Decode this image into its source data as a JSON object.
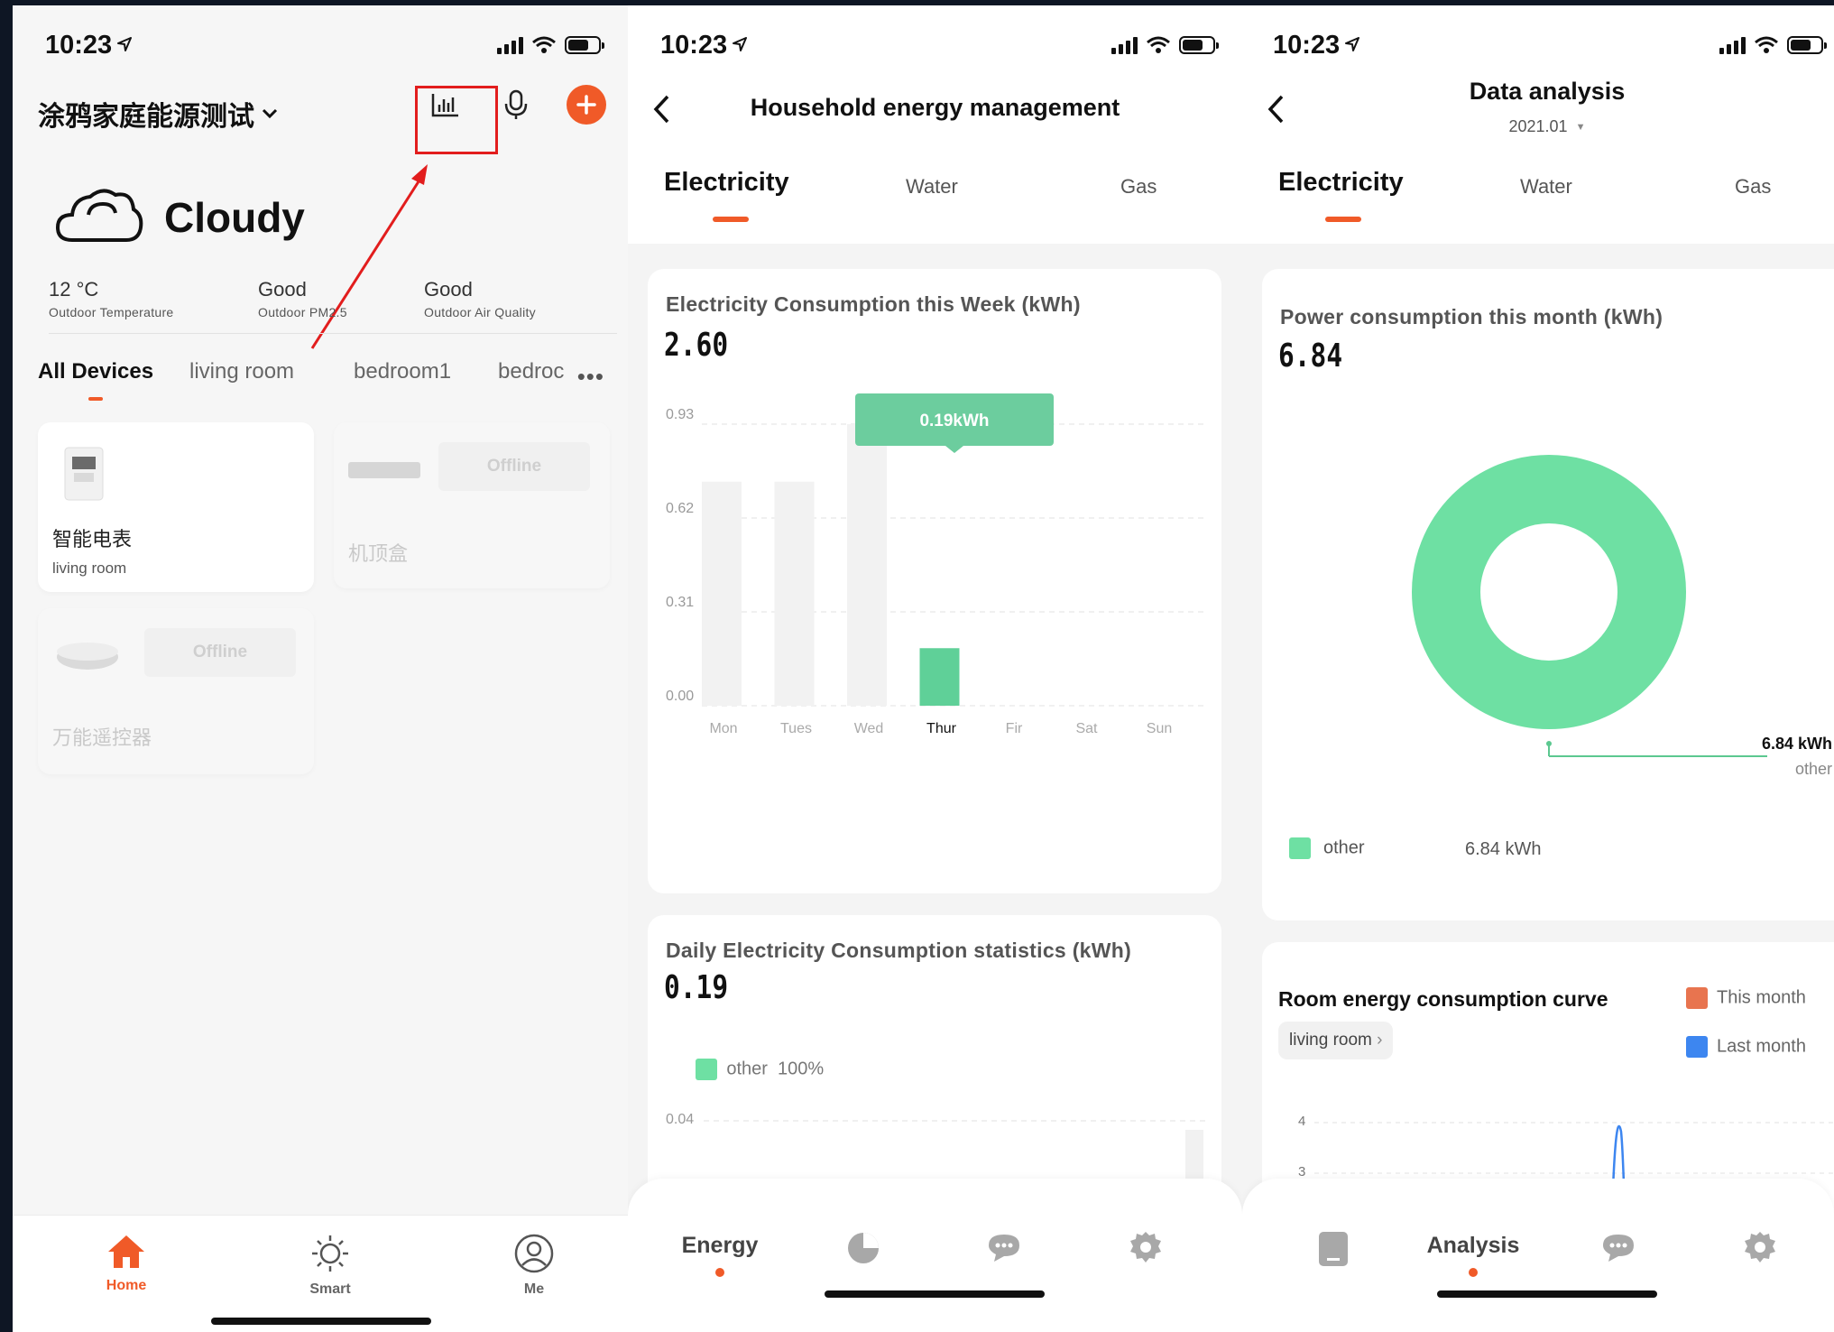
{
  "status": {
    "time": "10:23"
  },
  "home": {
    "title": "涂鸦家庭能源测试",
    "weather": {
      "condition": "Cloudy",
      "stats": [
        {
          "value": "12 °C",
          "label": "Outdoor Temperature"
        },
        {
          "value": "Good",
          "label": "Outdoor PM2.5"
        },
        {
          "value": "Good",
          "label": "Outdoor Air Quality"
        }
      ]
    },
    "room_tabs": [
      "All Devices",
      "living room",
      "bedroom1",
      "bedroc"
    ],
    "devices": [
      {
        "name": "智能电表",
        "room": "living room"
      },
      {
        "name": "机顶盒",
        "status": "Offline"
      },
      {
        "name": "万能遥控器",
        "status": "Offline"
      }
    ],
    "nav": [
      "Home",
      "Smart",
      "Me"
    ]
  },
  "energy": {
    "title": "Household energy management",
    "tabs": [
      "Electricity",
      "Water",
      "Gas"
    ],
    "week_card": {
      "title": "Electricity Consumption this Week (kWh)",
      "total": "2.60",
      "tooltip": "0.19kWh"
    },
    "daily_card": {
      "title": "Daily Electricity Consumption statistics (kWh)",
      "total": "0.19",
      "legend": "other  100%",
      "ytick": "0.04"
    },
    "nav": {
      "active_label": "Energy"
    }
  },
  "analysis": {
    "title": "Data analysis",
    "period": "2021.01",
    "tabs": [
      "Electricity",
      "Water",
      "Gas"
    ],
    "month_card": {
      "title": "Power consumption this month (kWh)",
      "total": "6.84",
      "callout_value": "6.84 kWh",
      "callout_label": "other",
      "legend_label": "other",
      "legend_value": "6.84 kWh"
    },
    "curve_card": {
      "title": "Room energy consumption curve",
      "room": "living room",
      "legend": [
        "This month",
        "Last month"
      ],
      "yticks": [
        "4",
        "3"
      ]
    },
    "nav": {
      "active_label": "Analysis"
    }
  },
  "colors": {
    "accent": "#f05a28",
    "green": "#6ee0a3",
    "bar_green": "#5fd098",
    "blue": "#3d86f0",
    "annotation_red": "#e21d1d"
  },
  "chart_data": [
    {
      "type": "bar",
      "title": "Electricity Consumption this Week (kWh)",
      "categories": [
        "Mon",
        "Tues",
        "Wed",
        "Thur",
        "Fir",
        "Sat",
        "Sun"
      ],
      "values": [
        0.74,
        0.74,
        0.93,
        0.19,
        0,
        0,
        0
      ],
      "yticks": [
        "0.93",
        "0.62",
        "0.31",
        "0.00"
      ],
      "ylim": [
        0,
        0.93
      ],
      "highlight": "Thur",
      "grid": true
    },
    {
      "type": "pie",
      "title": "Power consumption this month (kWh)",
      "labels": [
        "other"
      ],
      "values": [
        6.84
      ],
      "donut": true
    },
    {
      "type": "line",
      "title": "Room energy consumption curve",
      "series": [
        {
          "name": "This month"
        },
        {
          "name": "Last month"
        }
      ],
      "yticks": [
        "4",
        "3"
      ],
      "peak": 4.0
    }
  ]
}
